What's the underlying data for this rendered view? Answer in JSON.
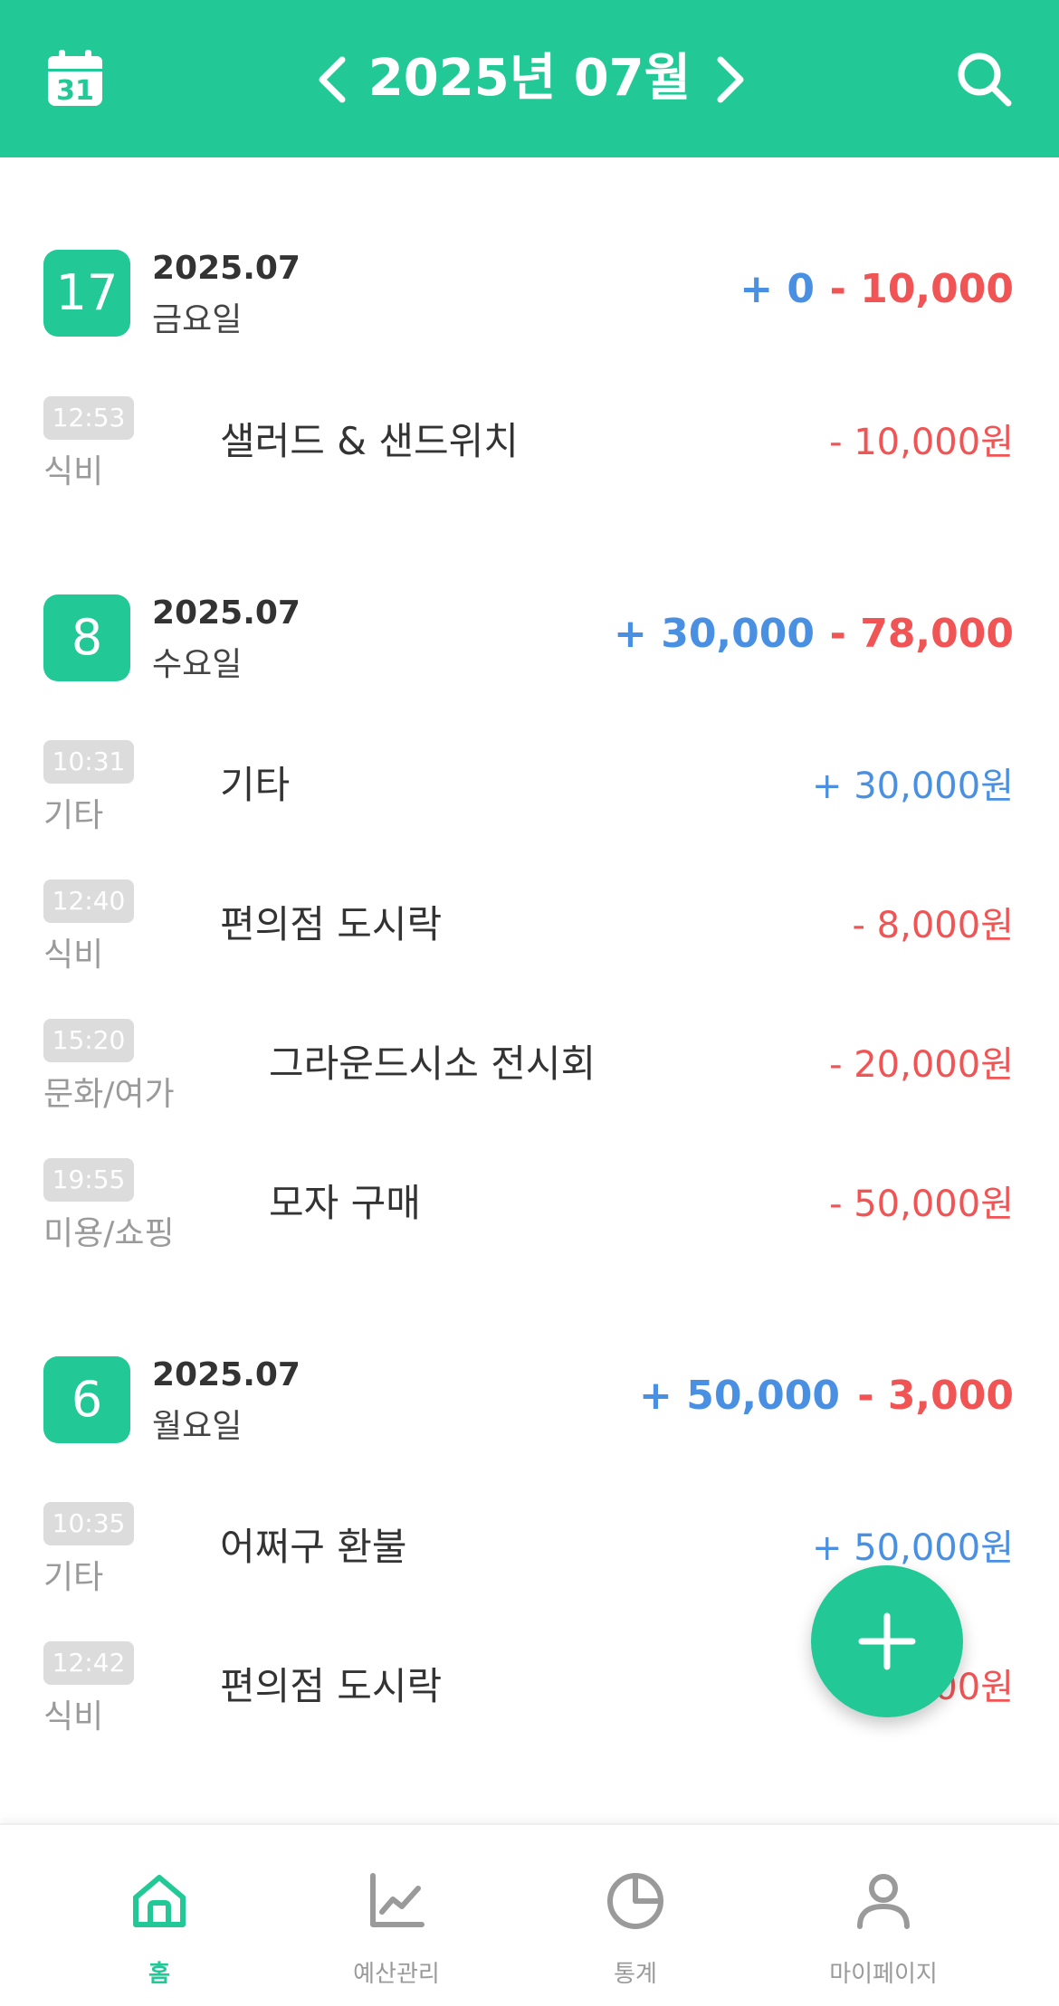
{
  "header": {
    "title": "2025년 07월",
    "icons": {
      "calendar": "calendar-icon",
      "calendar_day": "31",
      "prev": "chevron-left-icon",
      "next": "chevron-right-icon",
      "search": "search-icon"
    }
  },
  "days": [
    {
      "day": "17",
      "year_month": "2025.07",
      "weekday": "금요일",
      "income": "+ 0",
      "expense": "- 10,000",
      "transactions": [
        {
          "time": "12:53",
          "category": "식비",
          "title": "샐러드 & 샌드위치",
          "amount": "- 10,000원",
          "type": "expense"
        }
      ]
    },
    {
      "day": "8",
      "year_month": "2025.07",
      "weekday": "수요일",
      "income": "+ 30,000",
      "expense": "- 78,000",
      "transactions": [
        {
          "time": "10:31",
          "category": "기타",
          "title": "기타",
          "amount": "+ 30,000원",
          "type": "income"
        },
        {
          "time": "12:40",
          "category": "식비",
          "title": "편의점 도시락",
          "amount": "- 8,000원",
          "type": "expense"
        },
        {
          "time": "15:20",
          "category": "문화/여가",
          "title": "그라운드시소 전시회",
          "amount": "- 20,000원",
          "type": "expense"
        },
        {
          "time": "19:55",
          "category": "미용/쇼핑",
          "title": "모자 구매",
          "amount": "- 50,000원",
          "type": "expense"
        }
      ]
    },
    {
      "day": "6",
      "year_month": "2025.07",
      "weekday": "월요일",
      "income": "+ 50,000",
      "expense": "- 3,000",
      "transactions": [
        {
          "time": "10:35",
          "category": "기타",
          "title": "어쩌구 환불",
          "amount": "+ 50,000원",
          "type": "income"
        },
        {
          "time": "12:42",
          "category": "식비",
          "title": "편의점 도시락",
          "amount": "- 3,000원",
          "type": "expense"
        }
      ]
    }
  ],
  "fab": {
    "icon": "plus-icon"
  },
  "nav": {
    "items": [
      {
        "label": "홈",
        "icon": "home-icon",
        "active": true
      },
      {
        "label": "예산관리",
        "icon": "line-chart-icon",
        "active": false
      },
      {
        "label": "통계",
        "icon": "pie-chart-icon",
        "active": false
      },
      {
        "label": "마이페이지",
        "icon": "user-icon",
        "active": false
      }
    ]
  },
  "colors": {
    "accent": "#22c896",
    "income": "#4a90e2",
    "expense": "#f05454",
    "muted": "#9a9a9a",
    "time_badge": "#dcdcdc"
  }
}
